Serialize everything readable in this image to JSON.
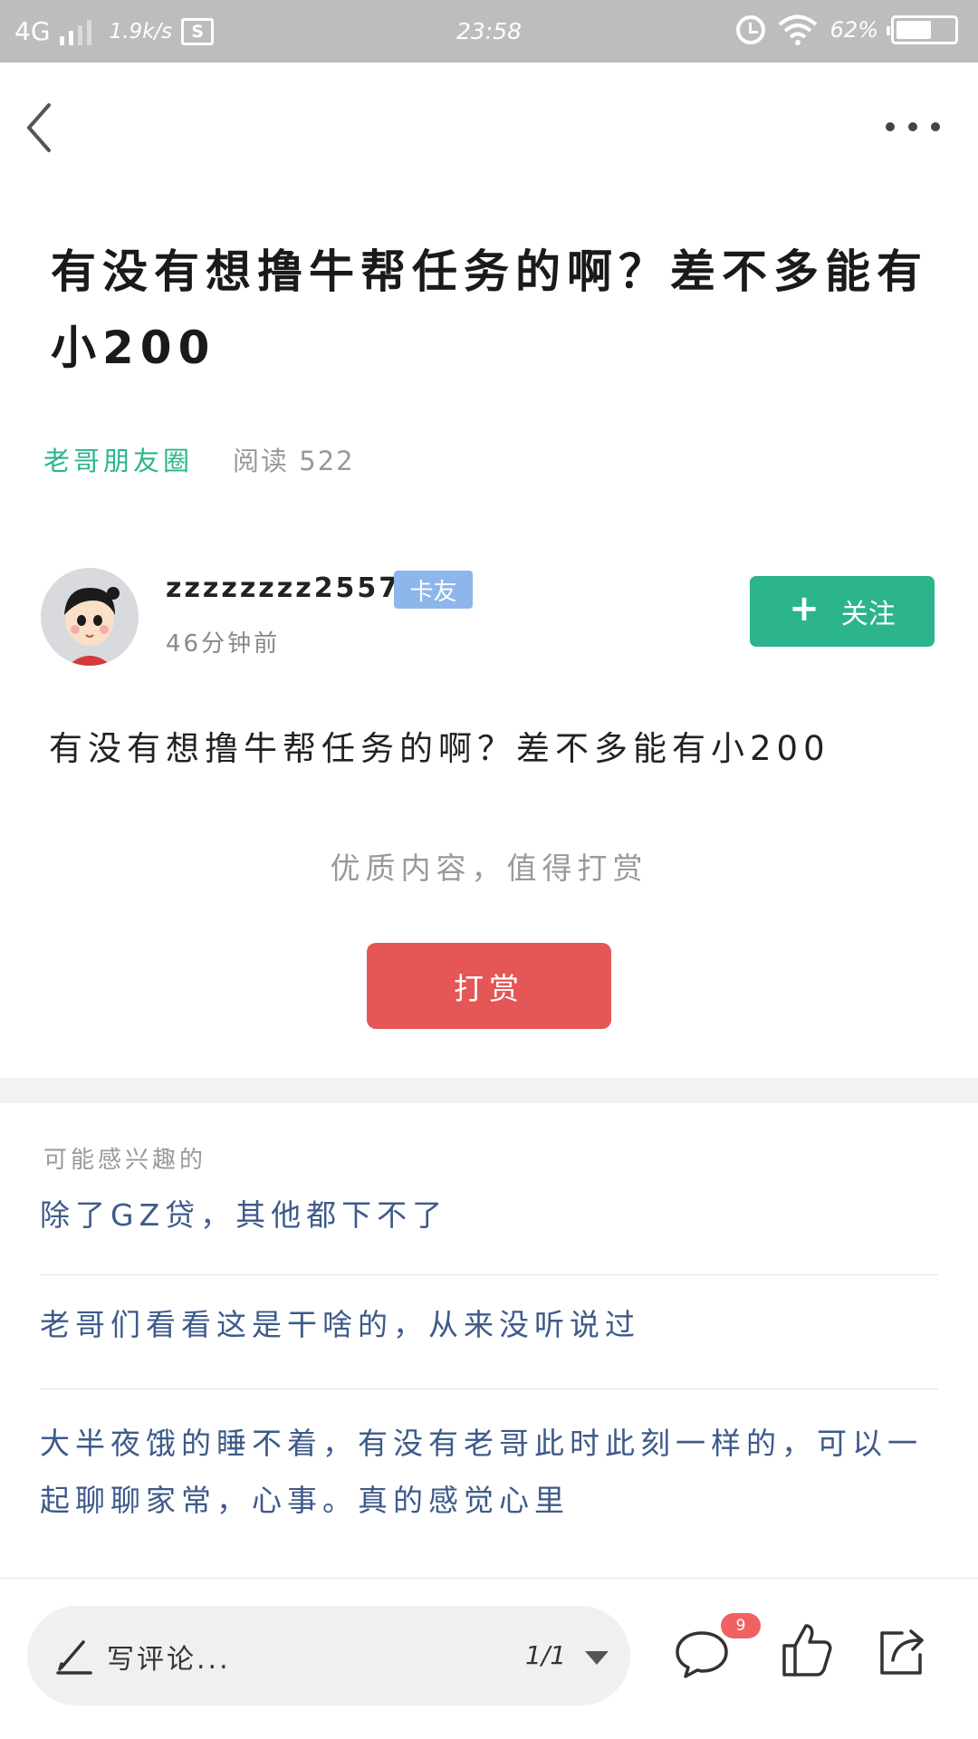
{
  "status_bar": {
    "network": "4G",
    "speed": "1.9k/s",
    "screenshot_glyph": "S",
    "time": "23:58",
    "battery": "62%",
    "battery_level": 0.62
  },
  "nav": {
    "back_icon": "chevron-left-icon",
    "more_icon": "more-horizontal-icon"
  },
  "post": {
    "title": "有没有想撸牛帮任务的啊？差不多能有小200",
    "circle": "老哥朋友圈",
    "read_label": "阅读",
    "read_count": "522",
    "body": "有没有想撸牛帮任务的啊？差不多能有小200"
  },
  "author": {
    "name": "zzzzzzzz2557",
    "badge": "卡友",
    "time": "46分钟前",
    "follow_label": "关注"
  },
  "reward": {
    "hint": "优质内容，值得打赏",
    "button_label": "打赏"
  },
  "related": {
    "heading": "可能感兴趣的",
    "items": [
      "除了GZ贷，其他都下不了",
      "老哥们看看这是干啥的，从来没听说过",
      "大半夜饿的睡不着，有没有老哥此时此刻一样的，可以一起聊聊家常，心事。真的感觉心里"
    ]
  },
  "bottom_bar": {
    "comment_placeholder": "写评论...",
    "page_indicator": "1/1",
    "comment_count": "9"
  },
  "colors": {
    "accent_green": "#2cb48c",
    "reward_red": "#e55656",
    "link_blue": "#3e5a8a",
    "badge_blue": "#8db6ea"
  }
}
